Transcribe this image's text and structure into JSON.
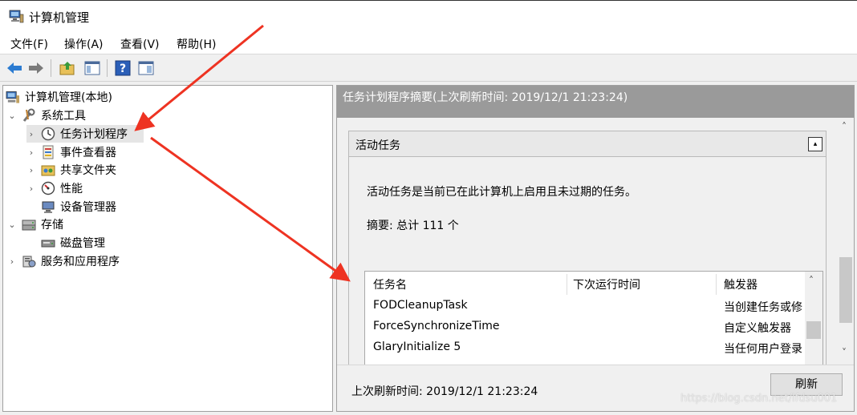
{
  "window": {
    "title": "计算机管理"
  },
  "menu": [
    "文件(F)",
    "操作(A)",
    "查看(V)",
    "帮助(H)"
  ],
  "toolbar": {
    "buttons": [
      "back-icon",
      "forward-icon",
      "up-folder-icon",
      "show-hide-tree-icon",
      "help-icon",
      "properties-icon"
    ]
  },
  "tree": {
    "root": "计算机管理(本地)",
    "system_tools": "系统工具",
    "task_scheduler": "任务计划程序",
    "event_viewer": "事件查看器",
    "shared_folders": "共享文件夹",
    "performance": "性能",
    "device_manager": "设备管理器",
    "storage": "存储",
    "disk_management": "磁盘管理",
    "services_apps": "服务和应用程序",
    "chevron_expanded": "⌄",
    "chevron_collapsed": "›"
  },
  "right": {
    "header": "任务计划程序摘要(上次刷新时间: 2019/12/1 21:23:24)",
    "section_title": "活动任务",
    "collapse_glyph": "▴",
    "description": "活动任务是当前已在此计算机上启用且未过期的任务。",
    "summary": "摘要: 总计 111 个",
    "columns": [
      "任务名",
      "下次运行时间",
      "触发器"
    ],
    "rows": [
      {
        "name": "FODCleanupTask",
        "next": "",
        "trigger": "当创建任务或修"
      },
      {
        "name": "ForceSynchronizeTime",
        "next": "",
        "trigger": "自定义触发器"
      },
      {
        "name": "GlaryInitialize 5",
        "next": "",
        "trigger": "当任何用户登录"
      }
    ],
    "last_refresh": "上次刷新时间: 2019/12/1 21:23:24",
    "refresh_label": "刷新",
    "scroll_up": "˄",
    "scroll_down": "˅"
  },
  "watermark": "https://blog.csdn.net/lfdsu001",
  "colors": {
    "annotation_arrow": "#ee3322",
    "header_bg": "#9a9a9a"
  }
}
